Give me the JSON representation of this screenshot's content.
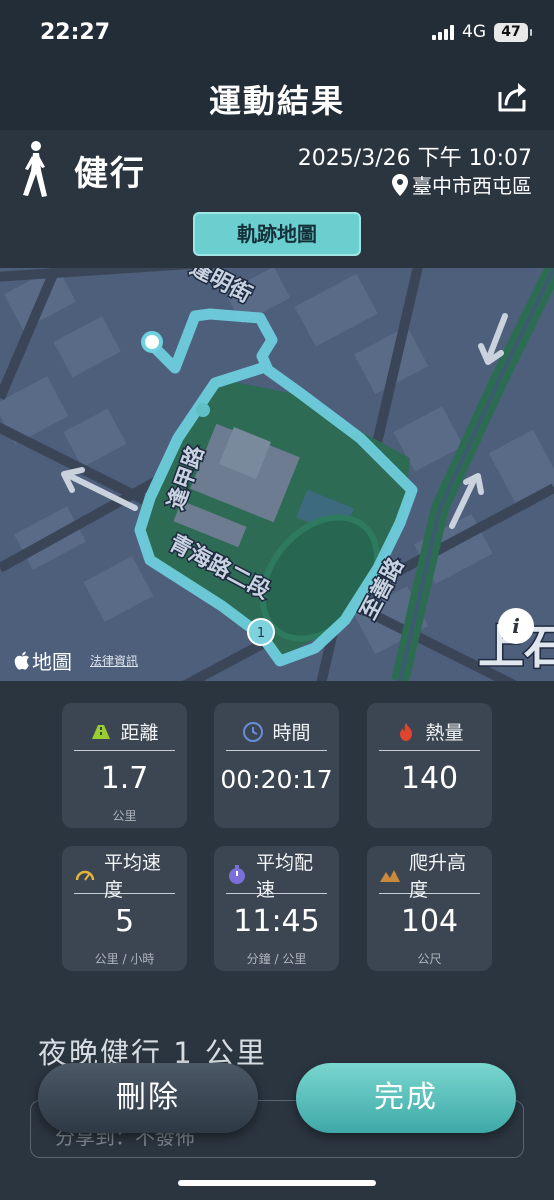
{
  "status_bar": {
    "time": "22:27",
    "network": "4G",
    "battery": "47"
  },
  "header": {
    "title": "運動結果",
    "share_icon": "share-icon"
  },
  "activity": {
    "type": "健行",
    "datetime": "2025/3/26 下午 10:07",
    "location": "臺中市西屯區",
    "map_tab_label": "軌跡地圖"
  },
  "map": {
    "streets": [
      "逢明街",
      "逢甲路",
      "青海路二段",
      "至善路",
      "上石"
    ],
    "marker_label": "1",
    "attribution": "地圖",
    "legal_label": "法律資訊",
    "info_icon": "i"
  },
  "stats": [
    {
      "label": "距離",
      "value": "1.7",
      "unit": "公里",
      "icon": "road-icon",
      "color": "#9acd32"
    },
    {
      "label": "時間",
      "value": "00:20:17",
      "unit": "",
      "icon": "clock-icon",
      "color": "#6a8bd8"
    },
    {
      "label": "熱量",
      "value": "140",
      "unit": "",
      "icon": "flame-icon",
      "color": "#e0452f"
    },
    {
      "label": "平均速度",
      "value": "5",
      "unit": "公里 / 小時",
      "icon": "speedometer-icon",
      "color": "#e3b23c"
    },
    {
      "label": "平均配速",
      "value": "11:45",
      "unit": "分鐘 / 公里",
      "icon": "stopwatch-icon",
      "color": "#7b6fd8"
    },
    {
      "label": "爬升高度",
      "value": "104",
      "unit": "公尺",
      "icon": "mountain-icon",
      "color": "#c98a3c"
    }
  ],
  "title_field": "夜晚健行 1 公里",
  "share_row": "分享到：不發佈",
  "buttons": {
    "delete": "刪除",
    "done": "完成"
  },
  "colors": {
    "accent": "#6ccfcf",
    "route": "#6fd0df",
    "background": "#2b3540"
  }
}
